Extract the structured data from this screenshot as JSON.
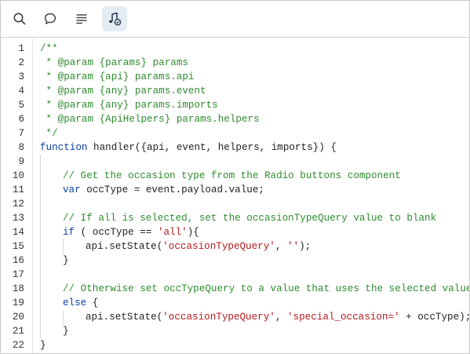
{
  "toolbar": {
    "buttons": [
      {
        "name": "search",
        "icon": "search-icon",
        "active": false
      },
      {
        "name": "comments",
        "icon": "speech-bubble-icon",
        "active": false
      },
      {
        "name": "format",
        "icon": "text-lines-icon",
        "active": false
      },
      {
        "name": "music-settings",
        "icon": "music-note-gear-icon",
        "active": true
      }
    ]
  },
  "colors": {
    "comment": "#2e8b2e",
    "keyword": "#0a3ea5",
    "string": "#b5181c",
    "plain": "#1f1f1f",
    "active_button_bg": "#e4ecf3"
  },
  "editor": {
    "lines": [
      {
        "number": "1",
        "indent": 0,
        "tokens": [
          {
            "t": "/**",
            "k": "comment"
          }
        ]
      },
      {
        "number": "2",
        "indent": 0,
        "tokens": [
          {
            "t": " * @param {params} params",
            "k": "comment"
          }
        ]
      },
      {
        "number": "3",
        "indent": 0,
        "tokens": [
          {
            "t": " * @param {api} params.api",
            "k": "comment"
          }
        ]
      },
      {
        "number": "4",
        "indent": 0,
        "tokens": [
          {
            "t": " * @param {any} params.event",
            "k": "comment"
          }
        ]
      },
      {
        "number": "5",
        "indent": 0,
        "tokens": [
          {
            "t": " * @param {any} params.imports",
            "k": "comment"
          }
        ]
      },
      {
        "number": "6",
        "indent": 0,
        "tokens": [
          {
            "t": " * @param {ApiHelpers} params.helpers",
            "k": "comment"
          }
        ]
      },
      {
        "number": "7",
        "indent": 0,
        "tokens": [
          {
            "t": " */",
            "k": "comment"
          }
        ]
      },
      {
        "number": "8",
        "indent": 0,
        "tokens": [
          {
            "t": "function",
            "k": "keyword"
          },
          {
            "t": " handler({api, event, helpers, imports}) {",
            "k": "plain"
          }
        ]
      },
      {
        "number": "9",
        "indent": 1,
        "tokens": []
      },
      {
        "number": "10",
        "indent": 1,
        "tokens": [
          {
            "t": "// Get the occasion type from the Radio buttons component",
            "k": "comment"
          }
        ]
      },
      {
        "number": "11",
        "indent": 1,
        "tokens": [
          {
            "t": "var",
            "k": "keyword"
          },
          {
            "t": " occType = event.payload.value;",
            "k": "plain"
          }
        ]
      },
      {
        "number": "12",
        "indent": 1,
        "tokens": []
      },
      {
        "number": "13",
        "indent": 1,
        "tokens": [
          {
            "t": "// If all is selected, set the occasionTypeQuery value to blank",
            "k": "comment"
          }
        ]
      },
      {
        "number": "14",
        "indent": 1,
        "tokens": [
          {
            "t": "if",
            "k": "keyword"
          },
          {
            "t": " ( occType == ",
            "k": "plain"
          },
          {
            "t": "'all'",
            "k": "string"
          },
          {
            "t": "){",
            "k": "plain"
          }
        ]
      },
      {
        "number": "15",
        "indent": 2,
        "tokens": [
          {
            "t": "api.setState(",
            "k": "plain"
          },
          {
            "t": "'occasionTypeQuery'",
            "k": "string"
          },
          {
            "t": ", ",
            "k": "plain"
          },
          {
            "t": "''",
            "k": "string"
          },
          {
            "t": ");",
            "k": "plain"
          }
        ]
      },
      {
        "number": "16",
        "indent": 1,
        "tokens": [
          {
            "t": "}",
            "k": "plain"
          }
        ]
      },
      {
        "number": "17",
        "indent": 1,
        "tokens": []
      },
      {
        "number": "18",
        "indent": 1,
        "tokens": [
          {
            "t": "// Otherwise set occTypeQuery to a value that uses the selected value",
            "k": "comment"
          }
        ]
      },
      {
        "number": "19",
        "indent": 1,
        "tokens": [
          {
            "t": "else",
            "k": "keyword"
          },
          {
            "t": " {",
            "k": "plain"
          }
        ]
      },
      {
        "number": "20",
        "indent": 2,
        "tokens": [
          {
            "t": "api.setState(",
            "k": "plain"
          },
          {
            "t": "'occasionTypeQuery'",
            "k": "string"
          },
          {
            "t": ", ",
            "k": "plain"
          },
          {
            "t": "'special_occasion='",
            "k": "string"
          },
          {
            "t": " + occType);",
            "k": "plain"
          }
        ]
      },
      {
        "number": "21",
        "indent": 1,
        "tokens": [
          {
            "t": "}",
            "k": "plain"
          }
        ]
      },
      {
        "number": "22",
        "indent": 0,
        "tokens": [
          {
            "t": "}",
            "k": "plain"
          }
        ]
      }
    ]
  }
}
